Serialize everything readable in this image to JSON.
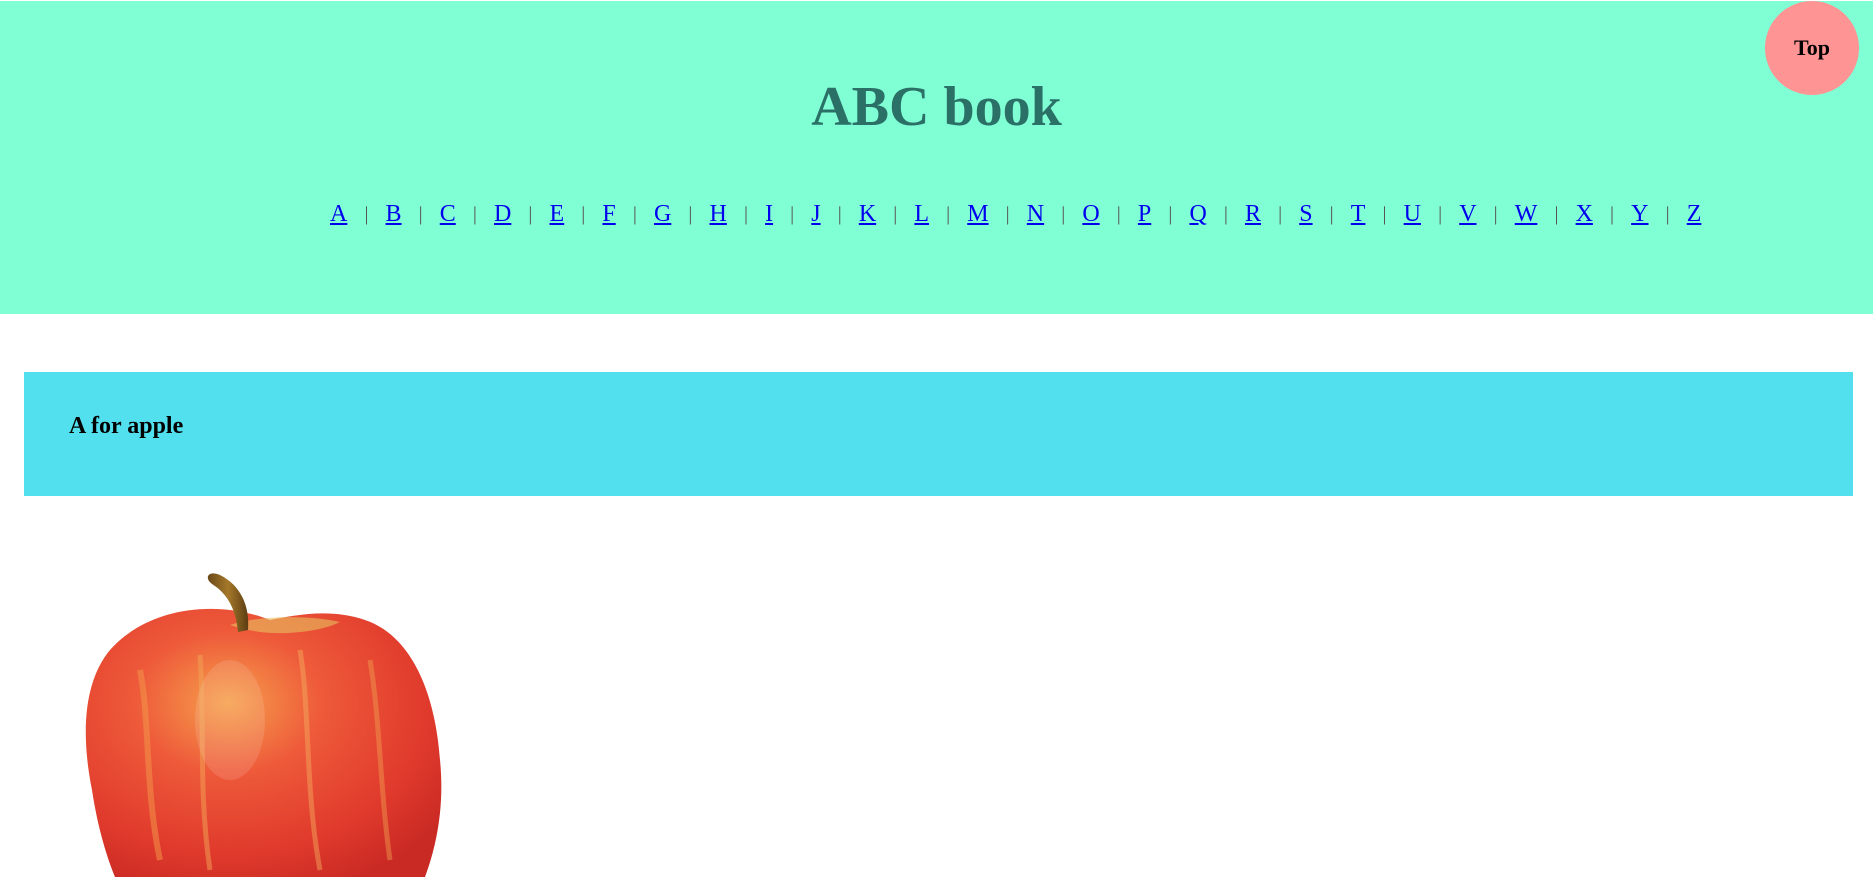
{
  "header": {
    "title": "ABC book",
    "letters": [
      "A",
      "B",
      "C",
      "D",
      "E",
      "F",
      "G",
      "H",
      "I",
      "J",
      "K",
      "L",
      "M",
      "N",
      "O",
      "P",
      "Q",
      "R",
      "S",
      "T",
      "U",
      "V",
      "W",
      "X",
      "Y",
      "Z"
    ],
    "separator": "|"
  },
  "top_button": {
    "label": "Top"
  },
  "section": {
    "heading": "A for apple",
    "image_icon": "apple-photo"
  },
  "colors": {
    "header_bg": "#80ffd4",
    "title": "#2a7067",
    "section_bg": "#52e0ef",
    "top_button_bg": "#ff9494",
    "link": "#0000ee"
  }
}
